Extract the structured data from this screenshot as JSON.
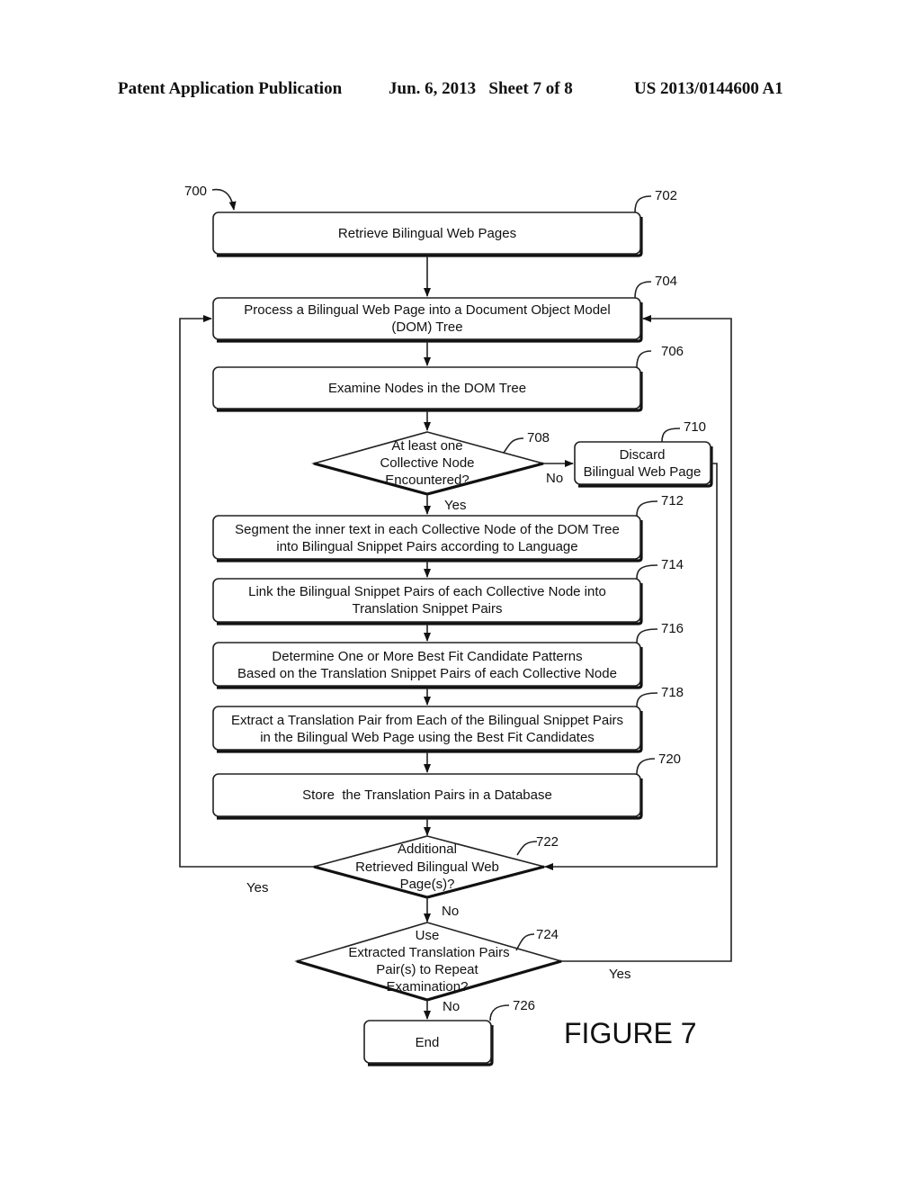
{
  "header": {
    "publication": "Patent Application Publication",
    "date_sheet": "Jun. 6, 2013   Sheet 7 of 8",
    "number": "US 2013/0144600 A1"
  },
  "figure": {
    "flow_ref": "700",
    "title": "FIGURE 7",
    "steps": [
      {
        "ref": "702",
        "type": "process",
        "lines": [
          "Retrieve Bilingual Web Pages"
        ]
      },
      {
        "ref": "704",
        "type": "process",
        "lines": [
          "Process a Bilingual Web Page into a Document Object Model",
          "(DOM) Tree"
        ]
      },
      {
        "ref": "706",
        "type": "process",
        "lines": [
          "Examine Nodes in the DOM Tree"
        ]
      },
      {
        "ref": "708",
        "type": "decision",
        "lines": [
          "At least one",
          "Collective Node",
          "Encountered?"
        ]
      },
      {
        "ref": "710",
        "type": "process",
        "lines": [
          "Discard",
          "Bilingual Web Page"
        ]
      },
      {
        "ref": "712",
        "type": "process",
        "lines": [
          "Segment the inner text in each Collective Node of the DOM Tree",
          "into Bilingual Snippet Pairs according to Language"
        ]
      },
      {
        "ref": "714",
        "type": "process",
        "lines": [
          "Link the Bilingual Snippet Pairs of each Collective Node into",
          "Translation Snippet Pairs"
        ]
      },
      {
        "ref": "716",
        "type": "process",
        "lines": [
          "Determine One or More Best Fit Candidate Patterns",
          "Based on the Translation Snippet Pairs of each Collective Node"
        ]
      },
      {
        "ref": "718",
        "type": "process",
        "lines": [
          "Extract a Translation Pair from Each of the Bilingual Snippet Pairs",
          "in the Bilingual Web Page using the Best Fit Candidates"
        ]
      },
      {
        "ref": "720",
        "type": "process",
        "lines": [
          "Store  the Translation Pairs in a Database"
        ]
      },
      {
        "ref": "722",
        "type": "decision",
        "lines": [
          "Additional",
          "Retrieved Bilingual Web",
          "Page(s)?"
        ]
      },
      {
        "ref": "724",
        "type": "decision",
        "lines": [
          "Use",
          "Extracted Translation Pairs",
          "Pair(s) to Repeat",
          "Examination?"
        ]
      },
      {
        "ref": "726",
        "type": "terminal",
        "lines": [
          "End"
        ]
      }
    ],
    "edge_labels": {
      "d708_no": "No",
      "d708_yes": "Yes",
      "d722_yes": "Yes",
      "d722_no": "No",
      "d724_yes": "Yes",
      "d724_no": "No"
    }
  }
}
